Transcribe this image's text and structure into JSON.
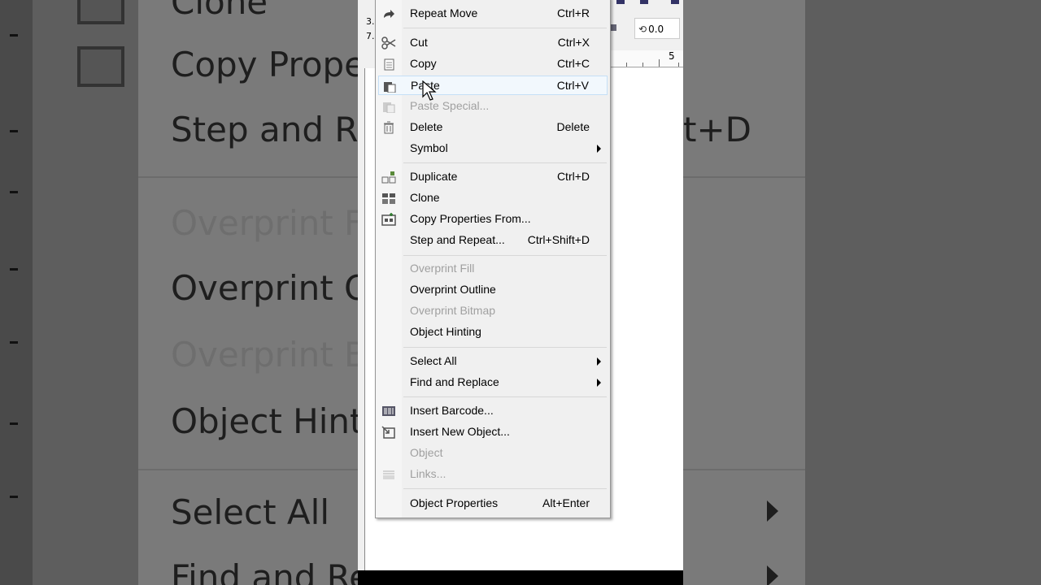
{
  "background_menu": {
    "items": [
      "Clone",
      "Copy Prope",
      "Step and Re",
      "Overprint Fi",
      "Overprint O",
      "Overprint B",
      "Object Hint",
      "Select All",
      "Find and Re"
    ],
    "right_fragment": "t+D"
  },
  "app": {
    "rotation_value": "0.0",
    "ruler_label": "5",
    "side_numbers": [
      "3.",
      "7."
    ]
  },
  "menu": {
    "items": [
      {
        "label": "Repeat Move",
        "shortcut": "Ctrl+R",
        "icon": "redo-arrow-icon",
        "enabled": true
      },
      {
        "label": "Cut",
        "shortcut": "Ctrl+X",
        "icon": "scissors-icon",
        "enabled": true
      },
      {
        "label": "Copy",
        "shortcut": "Ctrl+C",
        "icon": "copy-icon",
        "enabled": true
      },
      {
        "label": "Paste",
        "shortcut": "Ctrl+V",
        "icon": "paste-icon",
        "enabled": true,
        "hovered": true
      },
      {
        "label": "Paste Special...",
        "shortcut": "",
        "icon": "paste-special-icon",
        "enabled": false
      },
      {
        "label": "Delete",
        "shortcut": "Delete",
        "icon": "trash-icon",
        "enabled": true
      },
      {
        "label": "Symbol",
        "shortcut": "",
        "icon": "",
        "enabled": true,
        "submenu": true
      },
      {
        "label": "Duplicate",
        "shortcut": "Ctrl+D",
        "icon": "duplicate-icon",
        "enabled": true
      },
      {
        "label": "Clone",
        "shortcut": "",
        "icon": "clone-icon",
        "enabled": true
      },
      {
        "label": "Copy Properties From...",
        "shortcut": "",
        "icon": "copy-properties-icon",
        "enabled": true
      },
      {
        "label": "Step and Repeat...",
        "shortcut": "Ctrl+Shift+D",
        "icon": "",
        "enabled": true
      },
      {
        "label": "Overprint Fill",
        "shortcut": "",
        "icon": "",
        "enabled": false
      },
      {
        "label": "Overprint Outline",
        "shortcut": "",
        "icon": "",
        "enabled": true
      },
      {
        "label": "Overprint Bitmap",
        "shortcut": "",
        "icon": "",
        "enabled": false
      },
      {
        "label": "Object Hinting",
        "shortcut": "",
        "icon": "",
        "enabled": true
      },
      {
        "label": "Select All",
        "shortcut": "",
        "icon": "",
        "enabled": true,
        "submenu": true
      },
      {
        "label": "Find and Replace",
        "shortcut": "",
        "icon": "",
        "enabled": true,
        "submenu": true
      },
      {
        "label": "Insert Barcode...",
        "shortcut": "",
        "icon": "barcode-icon",
        "enabled": true
      },
      {
        "label": "Insert New Object...",
        "shortcut": "",
        "icon": "insert-object-icon",
        "enabled": true
      },
      {
        "label": "Object",
        "shortcut": "",
        "icon": "",
        "enabled": false
      },
      {
        "label": "Links...",
        "shortcut": "",
        "icon": "ole-links-icon",
        "enabled": false
      },
      {
        "label": "Object Properties",
        "shortcut": "Alt+Enter",
        "icon": "",
        "enabled": true
      }
    ]
  }
}
